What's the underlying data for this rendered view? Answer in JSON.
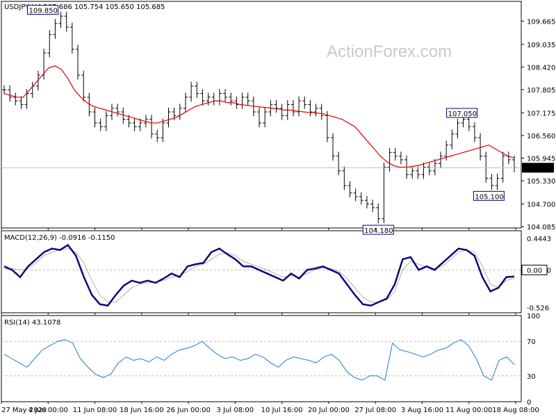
{
  "chart_data": [
    {
      "type": "line",
      "panel": "price",
      "title": "USDJPY,H4  105.686 105.754 105.650 105.685",
      "watermark": "ActionForex.com",
      "ylim": [
        104.05,
        110.2
      ],
      "y_ticks": [
        "109.665",
        "109.035",
        "108.420",
        "107.805",
        "107.175",
        "106.560",
        "105.945",
        "105.330",
        "104.700",
        "104.085"
      ],
      "current_price": "105.685",
      "colors": {
        "bars": "#000000",
        "moving_average": "#e00000",
        "labels": "#000080"
      },
      "annotations": [
        {
          "text": "109.850",
          "x": "4 Jun 00:00",
          "y": 109.85
        },
        {
          "text": "104.180",
          "x": "30 Jul",
          "y": 104.18
        },
        {
          "text": "107.050",
          "x": "13 Aug",
          "y": 107.05
        },
        {
          "text": "105.100",
          "x": "18 Aug",
          "y": 105.1
        }
      ],
      "x_ticks": [
        "27 May 2020",
        "4 Jun 00:00",
        "11 Jun 08:00",
        "18 Jun 16:00",
        "26 Jun 00:00",
        "3 Jul 08:00",
        "10 Jul 16:00",
        "20 Jul 00:00",
        "27 Jul 08:00",
        "3 Aug 16:00",
        "11 Aug 00:00",
        "18 Aug 08:00"
      ],
      "series": [
        {
          "values": [
            107.8,
            107.6,
            107.5,
            107.4,
            107.7,
            107.9,
            108.2,
            108.8,
            109.3,
            109.6,
            109.8,
            109.5,
            108.9,
            108.2,
            107.6,
            107.2,
            106.9,
            106.8,
            107.1,
            107.3,
            107.2,
            107.0,
            106.9,
            106.8,
            106.9,
            107.0,
            106.6,
            106.5,
            106.9,
            107.2,
            107.1,
            107.3,
            107.6,
            107.9,
            107.7,
            107.5,
            107.6,
            107.5,
            107.7,
            107.6,
            107.5,
            107.4,
            107.6,
            107.5,
            107.2,
            106.9,
            107.2,
            107.4,
            107.3,
            107.1,
            107.4,
            107.2,
            107.5,
            107.4,
            107.2,
            107.3,
            107.1,
            106.5,
            106.0,
            105.6,
            105.2,
            105.0,
            104.9,
            104.8,
            104.7,
            104.6,
            104.3,
            105.7,
            106.1,
            106.0,
            105.9,
            105.5,
            105.6,
            105.5,
            105.7,
            105.6,
            105.8,
            106.0,
            106.3,
            106.6,
            106.9,
            107.0,
            106.8,
            106.5,
            106.0,
            105.4,
            105.2,
            105.4,
            106.0,
            105.9,
            105.685
          ]
        },
        {
          "values": [
            107.7,
            107.65,
            107.6,
            107.6,
            107.8,
            108.0,
            108.2,
            108.4,
            108.45,
            108.35,
            108.1,
            107.8,
            107.6,
            107.45,
            107.35,
            107.3,
            107.25,
            107.2,
            107.15,
            107.1,
            107.05,
            107.0,
            106.95,
            106.9,
            106.9,
            106.95,
            107.0,
            107.05,
            107.15,
            107.25,
            107.35,
            107.4,
            107.45,
            107.5,
            107.5,
            107.45,
            107.45,
            107.4,
            107.38,
            107.36,
            107.34,
            107.32,
            107.3,
            107.28,
            107.25,
            107.25,
            107.22,
            107.2,
            107.18,
            107.17,
            107.15,
            107.1,
            107.05,
            107.0,
            106.9,
            106.8,
            106.6,
            106.4,
            106.2,
            106.0,
            105.85,
            105.75,
            105.7,
            105.7,
            105.72,
            105.75,
            105.8,
            105.85,
            105.9,
            105.95,
            106.0,
            106.05,
            106.1,
            106.15,
            106.2,
            106.25,
            106.3,
            106.2,
            106.1,
            106.0,
            105.95
          ]
        }
      ]
    },
    {
      "type": "line",
      "panel": "macd",
      "title": "MACD(12,26,9) -0.0916 -0.1150",
      "ylim": [
        -0.6,
        0.55
      ],
      "y_ticks": [
        "0.4443",
        "0.0000",
        "-0.526"
      ],
      "current_marker": "0.00",
      "colors": {
        "macd": "#0a0a78",
        "signal": "#b0b0b0"
      },
      "series": [
        {
          "values": [
            0.05,
            0.0,
            -0.1,
            0.05,
            0.15,
            0.25,
            0.3,
            0.28,
            0.35,
            0.2,
            -0.1,
            -0.35,
            -0.48,
            -0.5,
            -0.35,
            -0.22,
            -0.15,
            -0.18,
            -0.15,
            -0.18,
            -0.12,
            -0.05,
            -0.1,
            0.05,
            0.08,
            0.1,
            0.25,
            0.3,
            0.22,
            0.15,
            0.05,
            0.05,
            0.0,
            -0.05,
            -0.1,
            -0.15,
            -0.05,
            -0.12,
            0.0,
            0.02,
            0.05,
            0.0,
            -0.05,
            -0.2,
            -0.35,
            -0.48,
            -0.5,
            -0.45,
            -0.4,
            -0.2,
            0.15,
            0.18,
            0.0,
            0.05,
            0.0,
            0.1,
            0.2,
            0.3,
            0.28,
            0.2,
            -0.1,
            -0.3,
            -0.25,
            -0.1,
            -0.0916
          ]
        },
        {
          "values": [
            0.02,
            0.02,
            0.0,
            0.02,
            0.1,
            0.2,
            0.25,
            0.28,
            0.3,
            0.25,
            0.1,
            -0.15,
            -0.35,
            -0.45,
            -0.45,
            -0.35,
            -0.25,
            -0.2,
            -0.18,
            -0.17,
            -0.15,
            -0.1,
            -0.08,
            -0.02,
            0.05,
            0.08,
            0.15,
            0.22,
            0.24,
            0.2,
            0.12,
            0.08,
            0.04,
            0.0,
            -0.05,
            -0.1,
            -0.08,
            -0.1,
            -0.05,
            0.0,
            0.03,
            0.02,
            -0.02,
            -0.12,
            -0.25,
            -0.38,
            -0.45,
            -0.45,
            -0.42,
            -0.3,
            0.0,
            0.12,
            0.08,
            0.04,
            0.02,
            0.05,
            0.15,
            0.25,
            0.28,
            0.25,
            0.05,
            -0.2,
            -0.25,
            -0.15,
            -0.115
          ]
        }
      ]
    },
    {
      "type": "line",
      "panel": "rsi",
      "title": "RSI(14) 43.1078",
      "ylim": [
        0,
        100
      ],
      "y_ticks": [
        "100",
        "70",
        "30",
        "0"
      ],
      "levels": [
        70,
        30
      ],
      "colors": {
        "rsi": "#1e78d2"
      },
      "series": [
        {
          "values": [
            55,
            50,
            45,
            40,
            50,
            60,
            65,
            70,
            72,
            68,
            50,
            40,
            32,
            28,
            32,
            45,
            52,
            48,
            50,
            46,
            52,
            48,
            55,
            60,
            62,
            65,
            70,
            62,
            55,
            50,
            52,
            48,
            50,
            55,
            52,
            45,
            40,
            48,
            52,
            50,
            48,
            45,
            52,
            55,
            48,
            35,
            28,
            25,
            30,
            30,
            25,
            68,
            60,
            58,
            55,
            52,
            55,
            60,
            62,
            68,
            72,
            65,
            50,
            30,
            25,
            48,
            52,
            43.1
          ]
        }
      ]
    }
  ]
}
